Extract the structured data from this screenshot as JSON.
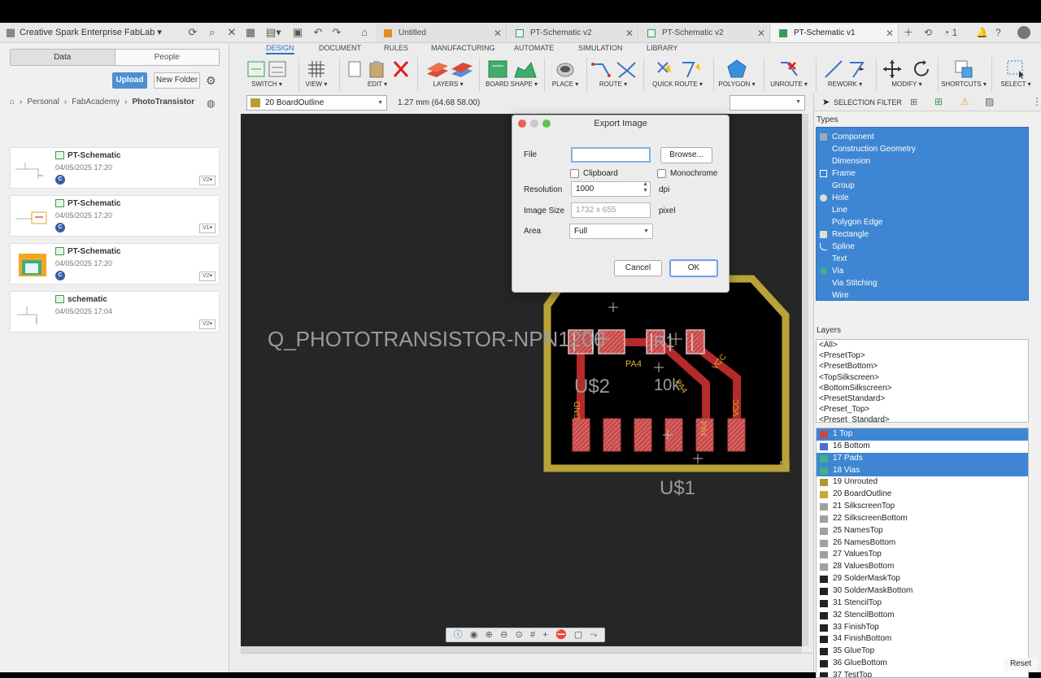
{
  "topbar": {
    "team": "Creative Spark Enterprise FabLab",
    "tabs": [
      {
        "label": "Untitled"
      },
      {
        "label": "PT-Schematic v2"
      },
      {
        "label": "PT-Schematic v2"
      },
      {
        "label": "PT-Schematic v1"
      }
    ],
    "job_count": "1"
  },
  "leftpanel": {
    "seg_data": "Data",
    "seg_people": "People",
    "upload": "Upload",
    "new_folder": "New Folder",
    "breadcrumb": [
      "Personal",
      "FabAcademy",
      "PhotoTransistor"
    ],
    "files": [
      {
        "name": "PT-Schematic",
        "date": "04/05/2025 17:20",
        "badge": "C",
        "version": "V2▾"
      },
      {
        "name": "PT-Schematic",
        "date": "04/05/2025 17:20",
        "badge": "C",
        "version": "V1▾"
      },
      {
        "name": "PT-Schematic",
        "date": "04/05/2025 17:20",
        "badge": "C",
        "version": "V2▾"
      },
      {
        "name": "schematic",
        "date": "04/05/2025 17:04",
        "badge": "",
        "version": "V2▾"
      }
    ]
  },
  "toolbar": {
    "tabs": [
      "DESIGN",
      "DOCUMENT",
      "RULES",
      "MANUFACTURING",
      "AUTOMATE",
      "SIMULATION",
      "LIBRARY"
    ],
    "tools": [
      "SWITCH ▾",
      "VIEW ▾",
      "EDIT ▾",
      "LAYERS ▾",
      "BOARD SHAPE ▾",
      "PLACE ▾",
      "ROUTE ▾",
      "QUICK ROUTE ▾",
      "POLYGON ▾",
      "UNROUTE ▾",
      "REWORK ▾",
      "MODIFY ▾",
      "SHORTCUTS ▾",
      "SELECT ▾"
    ]
  },
  "command": {
    "layer": "20 BoardOutline",
    "coord": "1.27 mm (64.68 58.00)"
  },
  "canvas": {
    "part_name": "Q_PHOTOTRANSISTOR-NPN1206",
    "u2": "U$2",
    "r1": "R1",
    "r1_value": "10k",
    "u1": "U$1",
    "pa4_a": "PA4",
    "pa4_b": "PA4",
    "pa4_c": "PA4",
    "gnd": "GND",
    "vcc_a": "VCC",
    "vcc_b": "VCC"
  },
  "dialog": {
    "title": "Export Image",
    "file_label": "File",
    "file_value": "",
    "browse": "Browse...",
    "clipboard": "Clipboard",
    "monochrome": "Monochrome",
    "resolution_label": "Resolution",
    "resolution_value": "1000",
    "dpi": "dpi",
    "size_label": "Image Size",
    "size_value": "1732 x 655",
    "pixel": "pixel",
    "area_label": "Area",
    "area_value": "Full",
    "cancel": "Cancel",
    "ok": "OK"
  },
  "rightpanel": {
    "selection_filter": "SELECTION FILTER",
    "types_heading": "Types",
    "types": [
      "Component",
      "Construction Geometry",
      "Dimension",
      "Frame",
      "Group",
      "Hole",
      "Line",
      "Polygon Edge",
      "Rectangle",
      "Spline",
      "Text",
      "Via",
      "Via Stitching",
      "Wire"
    ],
    "layers_heading": "Layers",
    "presets": [
      "<All>",
      "<PresetTop>",
      "<PresetBottom>",
      "<TopSilkscreen>",
      "<BottomSilkscreen>",
      "<PresetStandard>",
      "<Preset_Top>",
      "<Preset_Standard>"
    ],
    "layers": [
      {
        "label": "1 Top",
        "color": "#c84848",
        "selected": true
      },
      {
        "label": "16 Bottom",
        "color": "#4a6fd0",
        "selected": false
      },
      {
        "label": "17 Pads",
        "color": "#3fb08a",
        "selected": true
      },
      {
        "label": "18 Vias",
        "color": "#3fb08a",
        "selected": true
      },
      {
        "label": "19 Unrouted",
        "color": "#b09a2a",
        "selected": false
      },
      {
        "label": "20 BoardOutline",
        "color": "#c8a838",
        "selected": false
      },
      {
        "label": "21 SilkscreenTop",
        "color": "#a0a0a0",
        "selected": false
      },
      {
        "label": "22 SilkscreenBottom",
        "color": "#a0a0a0",
        "selected": false
      },
      {
        "label": "25 NamesTop",
        "color": "#a0a0a0",
        "selected": false
      },
      {
        "label": "26 NamesBottom",
        "color": "#a0a0a0",
        "selected": false
      },
      {
        "label": "27 ValuesTop",
        "color": "#a0a0a0",
        "selected": false
      },
      {
        "label": "28 ValuesBottom",
        "color": "#a0a0a0",
        "selected": false
      },
      {
        "label": "29 SolderMaskTop",
        "color": "#222222",
        "selected": false
      },
      {
        "label": "30 SolderMaskBottom",
        "color": "#222222",
        "selected": false
      },
      {
        "label": "31 StencilTop",
        "color": "#222222",
        "selected": false
      },
      {
        "label": "32 StencilBottom",
        "color": "#222222",
        "selected": false
      },
      {
        "label": "33 FinishTop",
        "color": "#222222",
        "selected": false
      },
      {
        "label": "34 FinishBottom",
        "color": "#222222",
        "selected": false
      },
      {
        "label": "35 GlueTop",
        "color": "#222222",
        "selected": false
      },
      {
        "label": "36 GlueBottom",
        "color": "#222222",
        "selected": false
      },
      {
        "label": "37 TestTop",
        "color": "#222222",
        "selected": false
      }
    ],
    "reset": "Reset"
  }
}
